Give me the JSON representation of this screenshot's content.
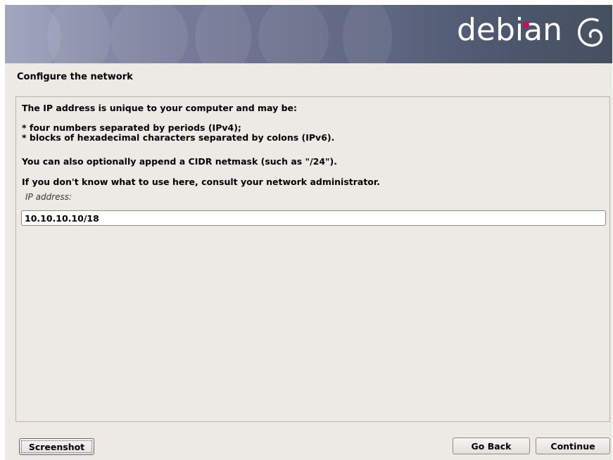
{
  "banner": {
    "logo_text": "debian",
    "brand_color": "#d70751",
    "logo_icon": "debian-swirl-icon"
  },
  "page": {
    "title": "Configure the network"
  },
  "description": {
    "line1": "The IP address is unique to your computer and may be:",
    "bullet1": " * four numbers separated by periods (IPv4);",
    "bullet2": " * blocks of hexadecimal characters separated by colons (IPv6).",
    "line2": "You can also optionally append a CIDR netmask (such as \"/24\").",
    "line3": "If you don't know what to use here, consult your network administrator."
  },
  "form": {
    "ip_label": "IP address:",
    "ip_value": "10.10.10.10/18"
  },
  "buttons": {
    "screenshot": "Screenshot",
    "go_back": "Go Back",
    "continue": "Continue"
  }
}
